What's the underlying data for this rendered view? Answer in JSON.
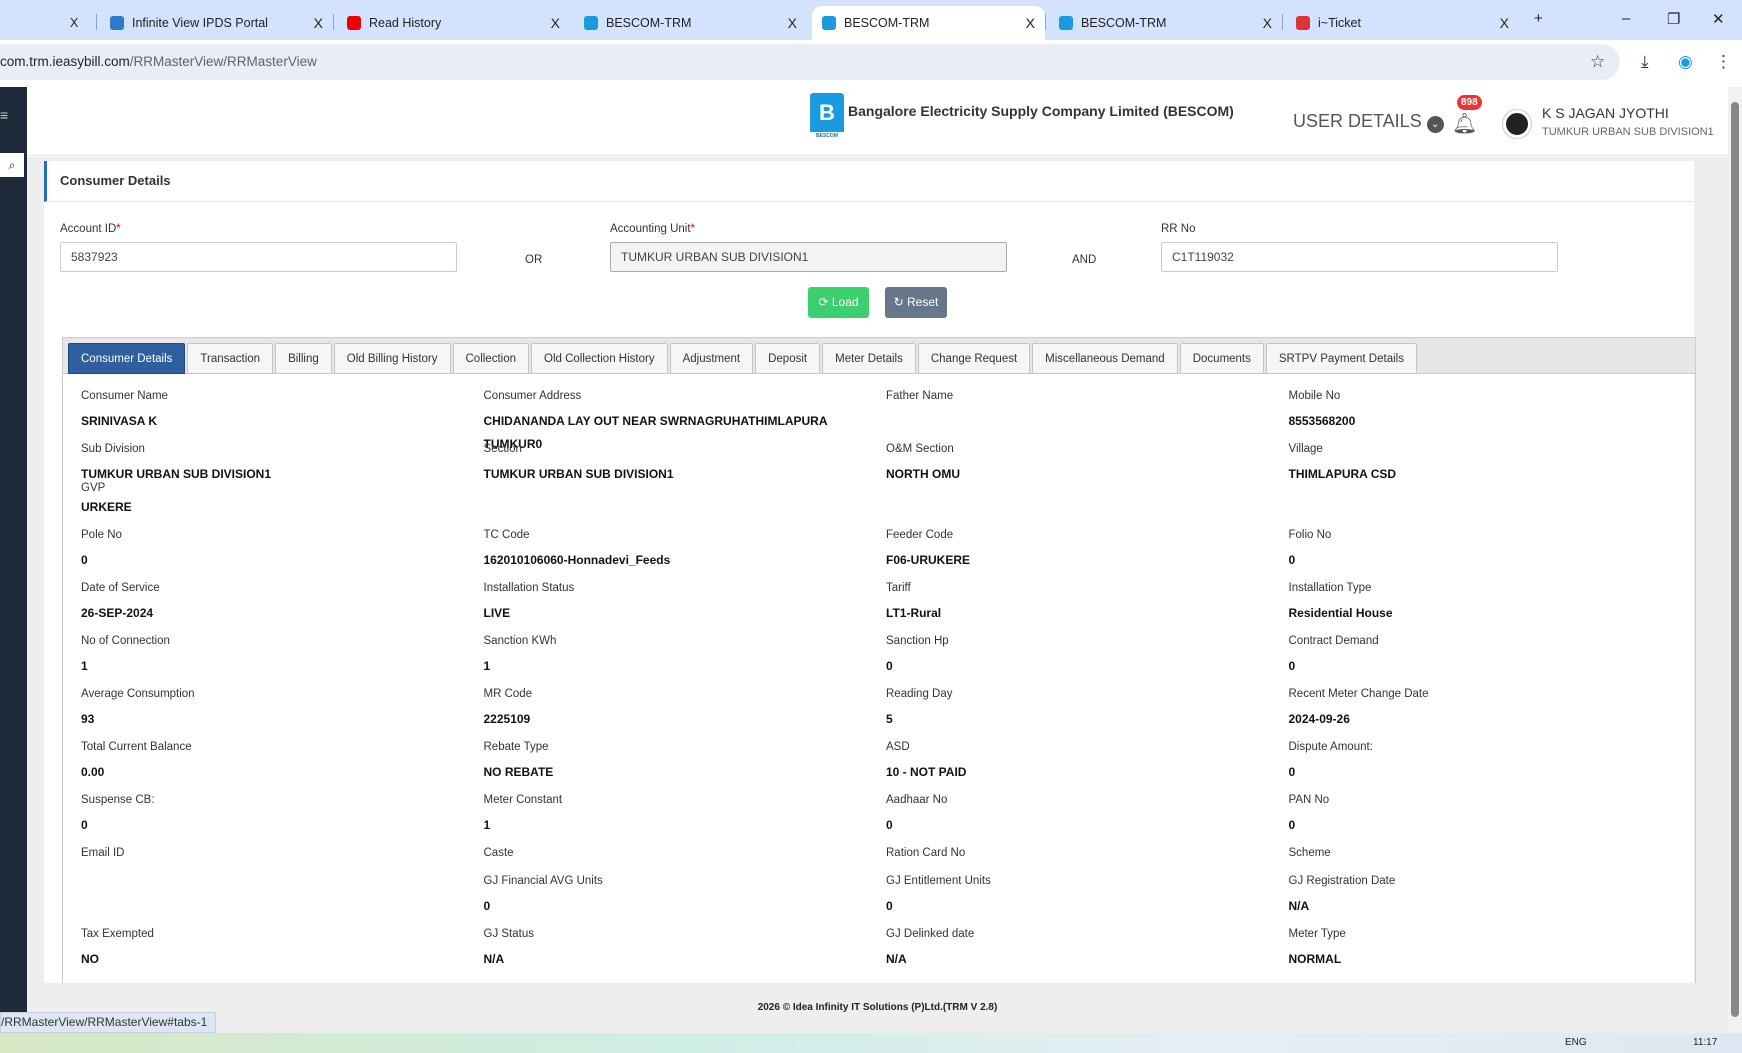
{
  "browser": {
    "tabs": [
      {
        "title": "Infinite View IPDS Portal",
        "color": "#2a7bc8"
      },
      {
        "title": "Read History",
        "color": "#e00"
      },
      {
        "title": "BESCOM-TRM",
        "color": "#1a9be0"
      },
      {
        "title": "BESCOM-TRM",
        "color": "#1a9be0"
      },
      {
        "title": "BESCOM-TRM",
        "color": "#1a9be0"
      },
      {
        "title": "i~Ticket",
        "color": "#d33"
      }
    ],
    "close": "X",
    "new_tab": "+",
    "url_host": "com.trm.ieasybill.com",
    "url_path": "/RRMasterView/RRMasterView",
    "status_url": "/RRMasterView/RRMasterView#tabs-1"
  },
  "header": {
    "company": "Bangalore Electricity Supply Company Limited (BESCOM)",
    "logo_text": "BESCOM",
    "user_details": "USER DETAILS",
    "notifications": "898",
    "user_name": "K S JAGAN JYOTHI",
    "user_unit": "TUMKUR URBAN SUB DIVISION1"
  },
  "card_title": "Consumer Details",
  "search": {
    "account_label": "Account ID",
    "account_value": "5837923",
    "or": "OR",
    "unit_label": "Accounting Unit",
    "unit_value": "TUMKUR URBAN SUB DIVISION1",
    "and": "AND",
    "rr_label": "RR No",
    "rr_value": "C1T119032",
    "load": "Load",
    "reset": "Reset",
    "required": "*"
  },
  "tabs": [
    "Consumer Details",
    "Transaction",
    "Billing",
    "Old Billing History",
    "Collection",
    "Old Collection History",
    "Adjustment",
    "Deposit",
    "Meter Details",
    "Change Request",
    "Miscellaneous Demand",
    "Documents",
    "SRTPV Payment Details"
  ],
  "rows": [
    [
      {
        "l": "Consumer Name",
        "v": "SRINIVASA K"
      },
      {
        "l": "Consumer Address",
        "v": "CHIDANANDA LAY OUT NEAR SWRNAGRUHATHIMLAPURA TUMKUR0"
      },
      {
        "l": "Father Name",
        "v": ""
      },
      {
        "l": "Mobile No",
        "v": "8553568200"
      }
    ],
    [
      {
        "l": "Sub Division",
        "v": "TUMKUR URBAN SUB DIVISION1",
        "l2": "GVP",
        "v2": "URKERE"
      },
      {
        "l": "Section",
        "v": "TUMKUR URBAN SUB DIVISION1"
      },
      {
        "l": "O&M Section",
        "v": "NORTH OMU"
      },
      {
        "l": "Village",
        "v": "THIMLAPURA CSD"
      }
    ],
    [
      {
        "l": "Pole No",
        "v": "0"
      },
      {
        "l": "TC Code",
        "v": "162010106060-Honnadevi_Feeds"
      },
      {
        "l": "Feeder Code",
        "v": "F06-URUKERE"
      },
      {
        "l": "Folio No",
        "v": "0"
      }
    ],
    [
      {
        "l": "Date of Service",
        "v": "26-SEP-2024"
      },
      {
        "l": "Installation Status",
        "v": "LIVE"
      },
      {
        "l": "Tariff",
        "v": "LT1-Rural"
      },
      {
        "l": "Installation Type",
        "v": "Residential House"
      }
    ],
    [
      {
        "l": "No of Connection",
        "v": "1"
      },
      {
        "l": "Sanction KWh",
        "v": "1"
      },
      {
        "l": "Sanction Hp",
        "v": "0"
      },
      {
        "l": "Contract Demand",
        "v": "0"
      }
    ],
    [
      {
        "l": "Average Consumption",
        "v": "93"
      },
      {
        "l": "MR Code",
        "v": "2225109"
      },
      {
        "l": "Reading Day",
        "v": "5"
      },
      {
        "l": "Recent Meter Change Date",
        "v": "2024-09-26"
      }
    ],
    [
      {
        "l": "Total Current Balance",
        "v": "0.00"
      },
      {
        "l": "Rebate Type",
        "v": "NO REBATE"
      },
      {
        "l": "ASD",
        "v": "10 - NOT PAID"
      },
      {
        "l": "Dispute Amount:",
        "v": "0"
      }
    ],
    [
      {
        "l": "Suspense CB:",
        "v": "0"
      },
      {
        "l": "Meter Constant",
        "v": "1"
      },
      {
        "l": "Aadhaar No",
        "v": "0"
      },
      {
        "l": "PAN No",
        "v": "0"
      }
    ],
    [
      {
        "l": "Email ID"
      },
      {
        "l": "Caste"
      },
      {
        "l": "Ration Card No"
      },
      {
        "l": "Scheme"
      }
    ],
    [
      {
        "l": "",
        "v": ""
      },
      {
        "l": "GJ Financial AVG Units",
        "v": "0"
      },
      {
        "l": "GJ Entitlement Units",
        "v": "0"
      },
      {
        "l": "GJ Registration Date",
        "v": "N/A"
      }
    ],
    [
      {
        "l": "Tax Exempted",
        "v": "NO"
      },
      {
        "l": "GJ Status",
        "v": "N/A"
      },
      {
        "l": "GJ Delinked date",
        "v": "N/A"
      },
      {
        "l": "Meter Type",
        "v": "NORMAL"
      }
    ]
  ],
  "footer": "2026 © Idea Infinity IT Solutions (P)Ltd.(TRM V 2.8)",
  "taskbar": {
    "lang": "ENG",
    "time": "11:17"
  }
}
